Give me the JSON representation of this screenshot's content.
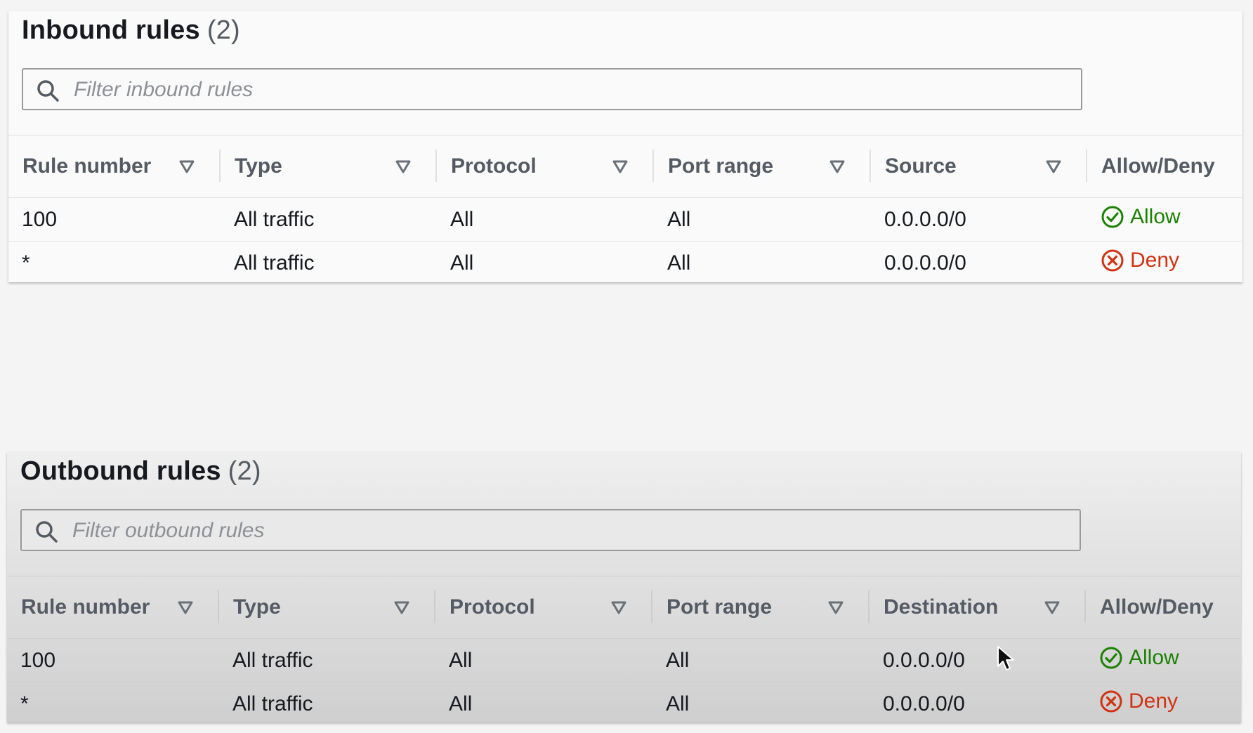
{
  "colors": {
    "allow": "#1d8102",
    "deny": "#d13212",
    "header_text": "#545b64"
  },
  "inbound": {
    "title": "Inbound rules",
    "count": "(2)",
    "filter_placeholder": "Filter inbound rules",
    "columns": [
      "Rule number",
      "Type",
      "Protocol",
      "Port range",
      "Source",
      "Allow/Deny"
    ],
    "rows": [
      {
        "rule_number": "100",
        "type": "All traffic",
        "protocol": "All",
        "port_range": "All",
        "source": "0.0.0.0/0",
        "action": "Allow",
        "action_icon": "check-circle-icon"
      },
      {
        "rule_number": "*",
        "type": "All traffic",
        "protocol": "All",
        "port_range": "All",
        "source": "0.0.0.0/0",
        "action": "Deny",
        "action_icon": "x-circle-icon"
      }
    ]
  },
  "outbound": {
    "title": "Outbound rules",
    "count": "(2)",
    "filter_placeholder": "Filter outbound rules",
    "columns": [
      "Rule number",
      "Type",
      "Protocol",
      "Port range",
      "Destination",
      "Allow/Deny"
    ],
    "rows": [
      {
        "rule_number": "100",
        "type": "All traffic",
        "protocol": "All",
        "port_range": "All",
        "destination": "0.0.0.0/0",
        "action": "Allow",
        "action_icon": "check-circle-icon"
      },
      {
        "rule_number": "*",
        "type": "All traffic",
        "protocol": "All",
        "port_range": "All",
        "destination": "0.0.0.0/0",
        "action": "Deny",
        "action_icon": "x-circle-icon"
      }
    ]
  }
}
